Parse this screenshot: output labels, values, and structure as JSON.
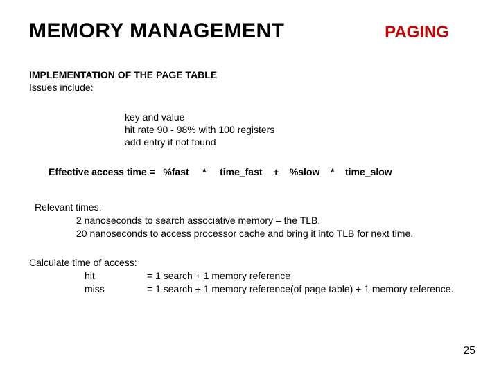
{
  "header": {
    "left": "MEMORY MANAGEMENT",
    "right": "PAGING"
  },
  "section": {
    "title": "IMPLEMENTATION OF THE PAGE TABLE",
    "lead": "Issues include:"
  },
  "bullets": {
    "b1": "key   and value",
    "b2": "hit rate 90 - 98% with 100 registers",
    "b3": "add entry if not found"
  },
  "formula": "Effective access time =   %fast     *     time_fast    +    %slow    *    time_slow",
  "relevant": {
    "heading": "Relevant times:",
    "l1": "2  nanoseconds to search associative memory – the TLB.",
    "l2": "20  nanoseconds to access processor cache and bring it into TLB for next time."
  },
  "calculate": {
    "heading": "Calculate time of access:",
    "hit_label": "hit",
    "hit_val": "=  1 search  + 1 memory reference",
    "miss_label": "miss",
    "miss_val": "=  1 search  + 1 memory reference(of page table) + 1 memory reference."
  },
  "page_number": "25"
}
